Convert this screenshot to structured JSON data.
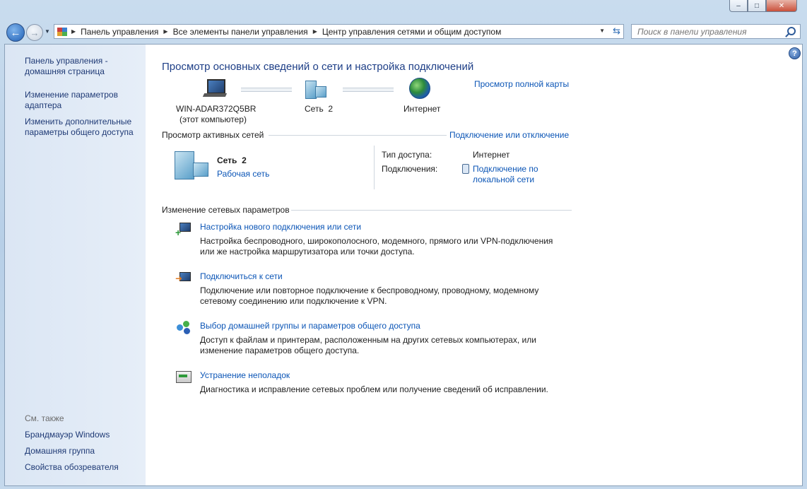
{
  "window": {
    "minimize_glyph": "‒",
    "maximize_glyph": "□",
    "close_glyph": "✕"
  },
  "nav": {
    "back_glyph": "←",
    "forward_glyph": "→",
    "breadcrumbs": [
      "Панель управления",
      "Все элементы панели управления",
      "Центр управления сетями и общим доступом"
    ],
    "search_placeholder": "Поиск в панели управления"
  },
  "sidebar": {
    "home_line1": "Панель управления -",
    "home_line2": "домашняя страница",
    "adapter_line1": "Изменение параметров",
    "adapter_line2": "адаптера",
    "sharing_line1": "Изменить дополнительные",
    "sharing_line2": "параметры общего доступа",
    "see_also": "См. также",
    "see_also_items": [
      "Брандмауэр Windows",
      "Домашняя группа",
      "Свойства обозревателя"
    ]
  },
  "main": {
    "title": "Просмотр основных сведений о сети и настройка подключений",
    "full_map_link": "Просмотр полной карты",
    "map": {
      "computer_name": "WIN-ADAR372Q5BR",
      "computer_note": "(этот компьютер)",
      "network_name": "Сеть  2",
      "internet": "Интернет"
    },
    "active_networks_header": "Просмотр активных сетей",
    "connect_disconnect_link": "Подключение или отключение",
    "active_network": {
      "name": "Сеть  2",
      "type_link": "Рабочая сеть",
      "access_type_label": "Тип доступа:",
      "access_type_value": "Интернет",
      "connections_label": "Подключения:",
      "connection_link_line1": "Подключение по",
      "connection_link_line2": "локальной сети"
    },
    "change_settings_header": "Изменение сетевых параметров",
    "tasks": [
      {
        "link": "Настройка нового подключения или сети",
        "desc1": "Настройка беспроводного, широкополосного, модемного, прямого или VPN-подключения",
        "desc2": "или же настройка маршрутизатора или точки доступа."
      },
      {
        "link": "Подключиться к сети",
        "desc1": "Подключение или повторное подключение к беспроводному, проводному, модемному",
        "desc2": "сетевому соединению или подключение к VPN."
      },
      {
        "link": "Выбор домашней группы и параметров общего доступа",
        "desc1": "Доступ к файлам и принтерам, расположенным на других сетевых компьютерах, или",
        "desc2": "изменение параметров общего доступа."
      },
      {
        "link": "Устранение неполадок",
        "desc1": "Диагностика и исправление сетевых проблем или получение сведений об исправлении.",
        "desc2": ""
      }
    ]
  },
  "colors": {
    "link": "#0b55b6",
    "title": "#1e3f87",
    "sidebar_link": "#1f3a75"
  }
}
